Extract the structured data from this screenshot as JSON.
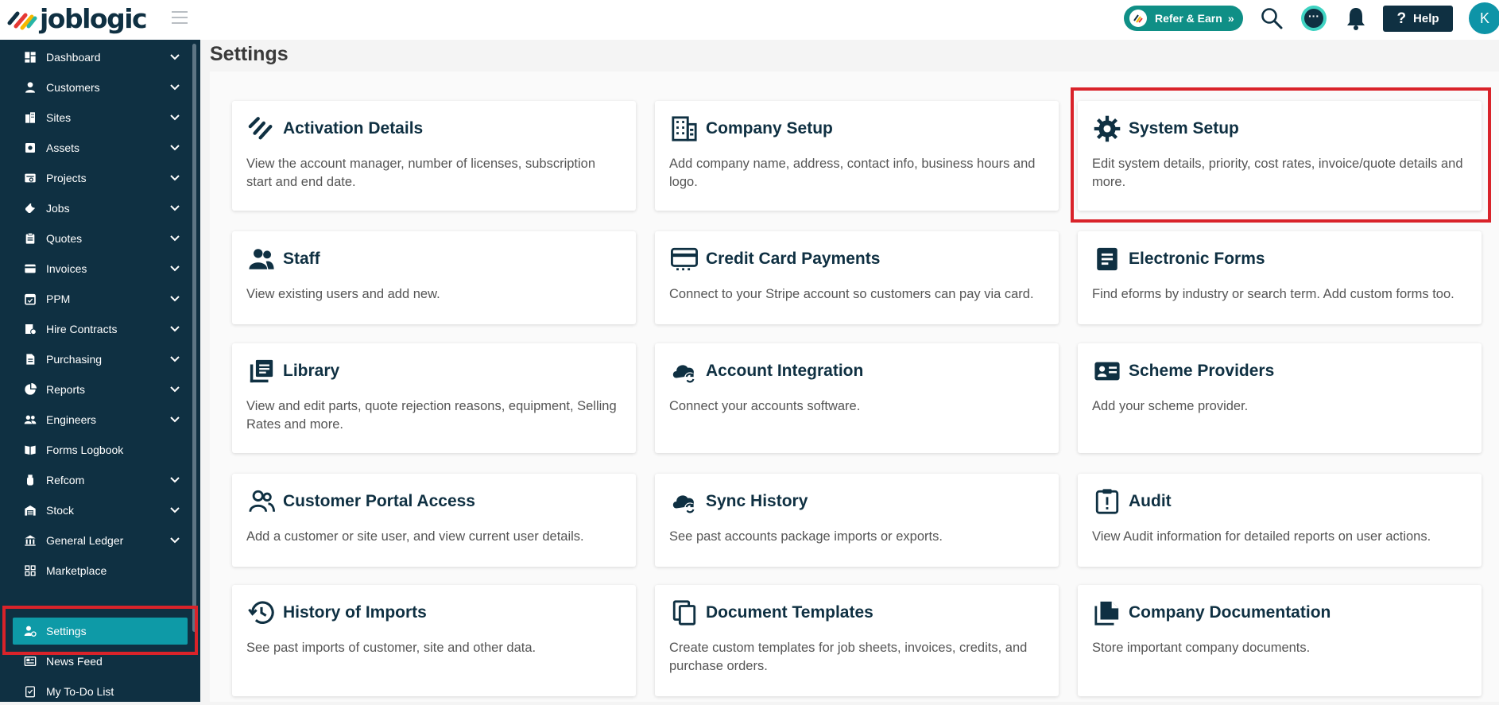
{
  "app": {
    "logo_text": "joblogic"
  },
  "header": {
    "refer_label": "Refer & Earn",
    "help_label": "Help",
    "avatar_initial": "K"
  },
  "colors": {
    "navy": "#0f3042",
    "teal": "#0e9aa7",
    "refer_green": "#0f8f86",
    "highlight_red": "#d9232a"
  },
  "sidebar": {
    "items": [
      {
        "label": "Dashboard",
        "icon": "dashboard-icon",
        "chevron": true
      },
      {
        "label": "Customers",
        "icon": "person-icon",
        "chevron": true
      },
      {
        "label": "Sites",
        "icon": "building-icon",
        "chevron": true
      },
      {
        "label": "Assets",
        "icon": "asset-icon",
        "chevron": true
      },
      {
        "label": "Projects",
        "icon": "projects-icon",
        "chevron": true
      },
      {
        "label": "Jobs",
        "icon": "wrench-icon",
        "chevron": true
      },
      {
        "label": "Quotes",
        "icon": "clipboard-icon",
        "chevron": true
      },
      {
        "label": "Invoices",
        "icon": "invoice-icon",
        "chevron": true
      },
      {
        "label": "PPM",
        "icon": "calendar-icon",
        "chevron": true
      },
      {
        "label": "Hire Contracts",
        "icon": "hire-icon",
        "chevron": true
      },
      {
        "label": "Purchasing",
        "icon": "document-icon",
        "chevron": true
      },
      {
        "label": "Reports",
        "icon": "pie-chart-icon",
        "chevron": true
      },
      {
        "label": "Engineers",
        "icon": "people-icon",
        "chevron": true
      },
      {
        "label": "Forms Logbook",
        "icon": "book-icon",
        "chevron": false
      },
      {
        "label": "Refcom",
        "icon": "cylinder-icon",
        "chevron": true
      },
      {
        "label": "Stock",
        "icon": "warehouse-icon",
        "chevron": true
      },
      {
        "label": "General Ledger",
        "icon": "bank-icon",
        "chevron": true
      },
      {
        "label": "Marketplace",
        "icon": "grid-icon",
        "chevron": false
      },
      {
        "label": "Settings",
        "icon": "user-gear-icon",
        "chevron": false,
        "active": true
      },
      {
        "label": "News Feed",
        "icon": "news-icon",
        "chevron": false
      },
      {
        "label": "My To-Do List",
        "icon": "checklist-icon",
        "chevron": false
      }
    ]
  },
  "page": {
    "title": "Settings"
  },
  "cards": [
    {
      "title": "Activation Details",
      "desc": "View the account manager, number of licenses, subscription start and end date.",
      "icon": "activation-icon"
    },
    {
      "title": "Company Setup",
      "desc": "Add company name, address, contact info, business hours and logo.",
      "icon": "company-building-icon"
    },
    {
      "title": "System Setup",
      "desc": "Edit system details, priority, cost rates, invoice/quote details and more.",
      "icon": "gear-icon"
    },
    {
      "title": "Staff",
      "desc": "View existing users and add new.",
      "icon": "staff-icon"
    },
    {
      "title": "Credit Card Payments",
      "desc": "Connect to your Stripe account so customers can pay via card.",
      "icon": "credit-card-icon"
    },
    {
      "title": "Electronic Forms",
      "desc": "Find eforms by industry or search term. Add custom forms too.",
      "icon": "form-icon"
    },
    {
      "title": "Library",
      "desc": "View and edit parts, quote rejection reasons, equipment, Selling Rates and more.",
      "icon": "library-icon"
    },
    {
      "title": "Account Integration",
      "desc": "Connect your accounts software.",
      "icon": "cloud-sync-icon"
    },
    {
      "title": "Scheme Providers",
      "desc": "Add your scheme provider.",
      "icon": "id-card-icon"
    },
    {
      "title": "Customer Portal Access",
      "desc": "Add a customer or site user, and view current user details.",
      "icon": "people-outline-icon"
    },
    {
      "title": "Sync History",
      "desc": "See past accounts package imports or exports.",
      "icon": "cloud-sync-icon"
    },
    {
      "title": "Audit",
      "desc": "View Audit information for detailed reports on user actions.",
      "icon": "audit-clipboard-icon"
    },
    {
      "title": "History of Imports",
      "desc": "See past imports of customer, site and other data.",
      "icon": "history-icon"
    },
    {
      "title": "Document Templates",
      "desc": "Create custom templates for job sheets, invoices, credits, and purchase orders.",
      "icon": "copy-icon"
    },
    {
      "title": "Company Documentation",
      "desc": "Store important company documents.",
      "icon": "file-stack-icon"
    }
  ]
}
